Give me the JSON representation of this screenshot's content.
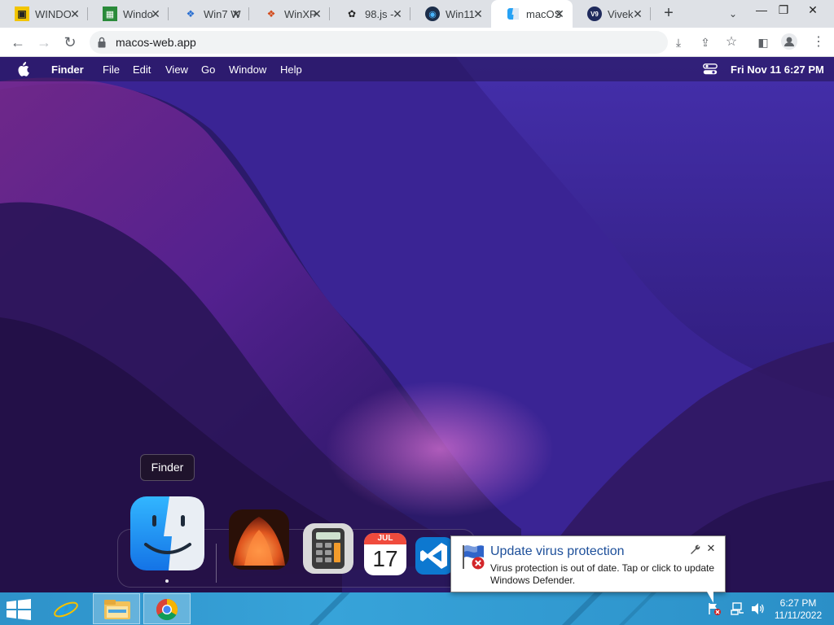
{
  "browser": {
    "tabs": [
      {
        "title": "WINDO",
        "icon": "windows93-icon",
        "active": false
      },
      {
        "title": "Windo",
        "icon": "windows-icon",
        "active": false
      },
      {
        "title": "Win7 W",
        "icon": "win7-icon",
        "active": false
      },
      {
        "title": "WinXP",
        "icon": "winxp-icon",
        "active": false
      },
      {
        "title": "98.js - ",
        "icon": "98js-icon",
        "active": false
      },
      {
        "title": "Win11",
        "icon": "win11-icon",
        "active": false
      },
      {
        "title": "macOS",
        "icon": "finder-icon",
        "active": true
      },
      {
        "title": "Vivek",
        "icon": "v9-icon",
        "badge": "V9",
        "active": false
      }
    ],
    "url": "macos-web.app"
  },
  "macos": {
    "menubar": {
      "app_name": "Finder",
      "menus": [
        "File",
        "Edit",
        "View",
        "Go",
        "Window",
        "Help"
      ],
      "clock": "Fri Nov 11   6:27 PM"
    },
    "dock": {
      "tooltip": "Finder",
      "apps": [
        "Finder",
        "Wallpapers",
        "Calculator",
        "Calendar",
        "VS Code"
      ],
      "calendar": {
        "month": "JUL",
        "day": "17"
      }
    }
  },
  "windows": {
    "taskbar": {
      "time": "6:27 PM",
      "date": "11/11/2022"
    },
    "notification": {
      "title": "Update virus protection",
      "body": "Virus protection is out of date. Tap or click to update Windows Defender."
    }
  },
  "colors": {
    "notification_title": "#1d4f9a",
    "taskbar": "#37a3d9",
    "wallpaper_base": "#3f1f86"
  }
}
